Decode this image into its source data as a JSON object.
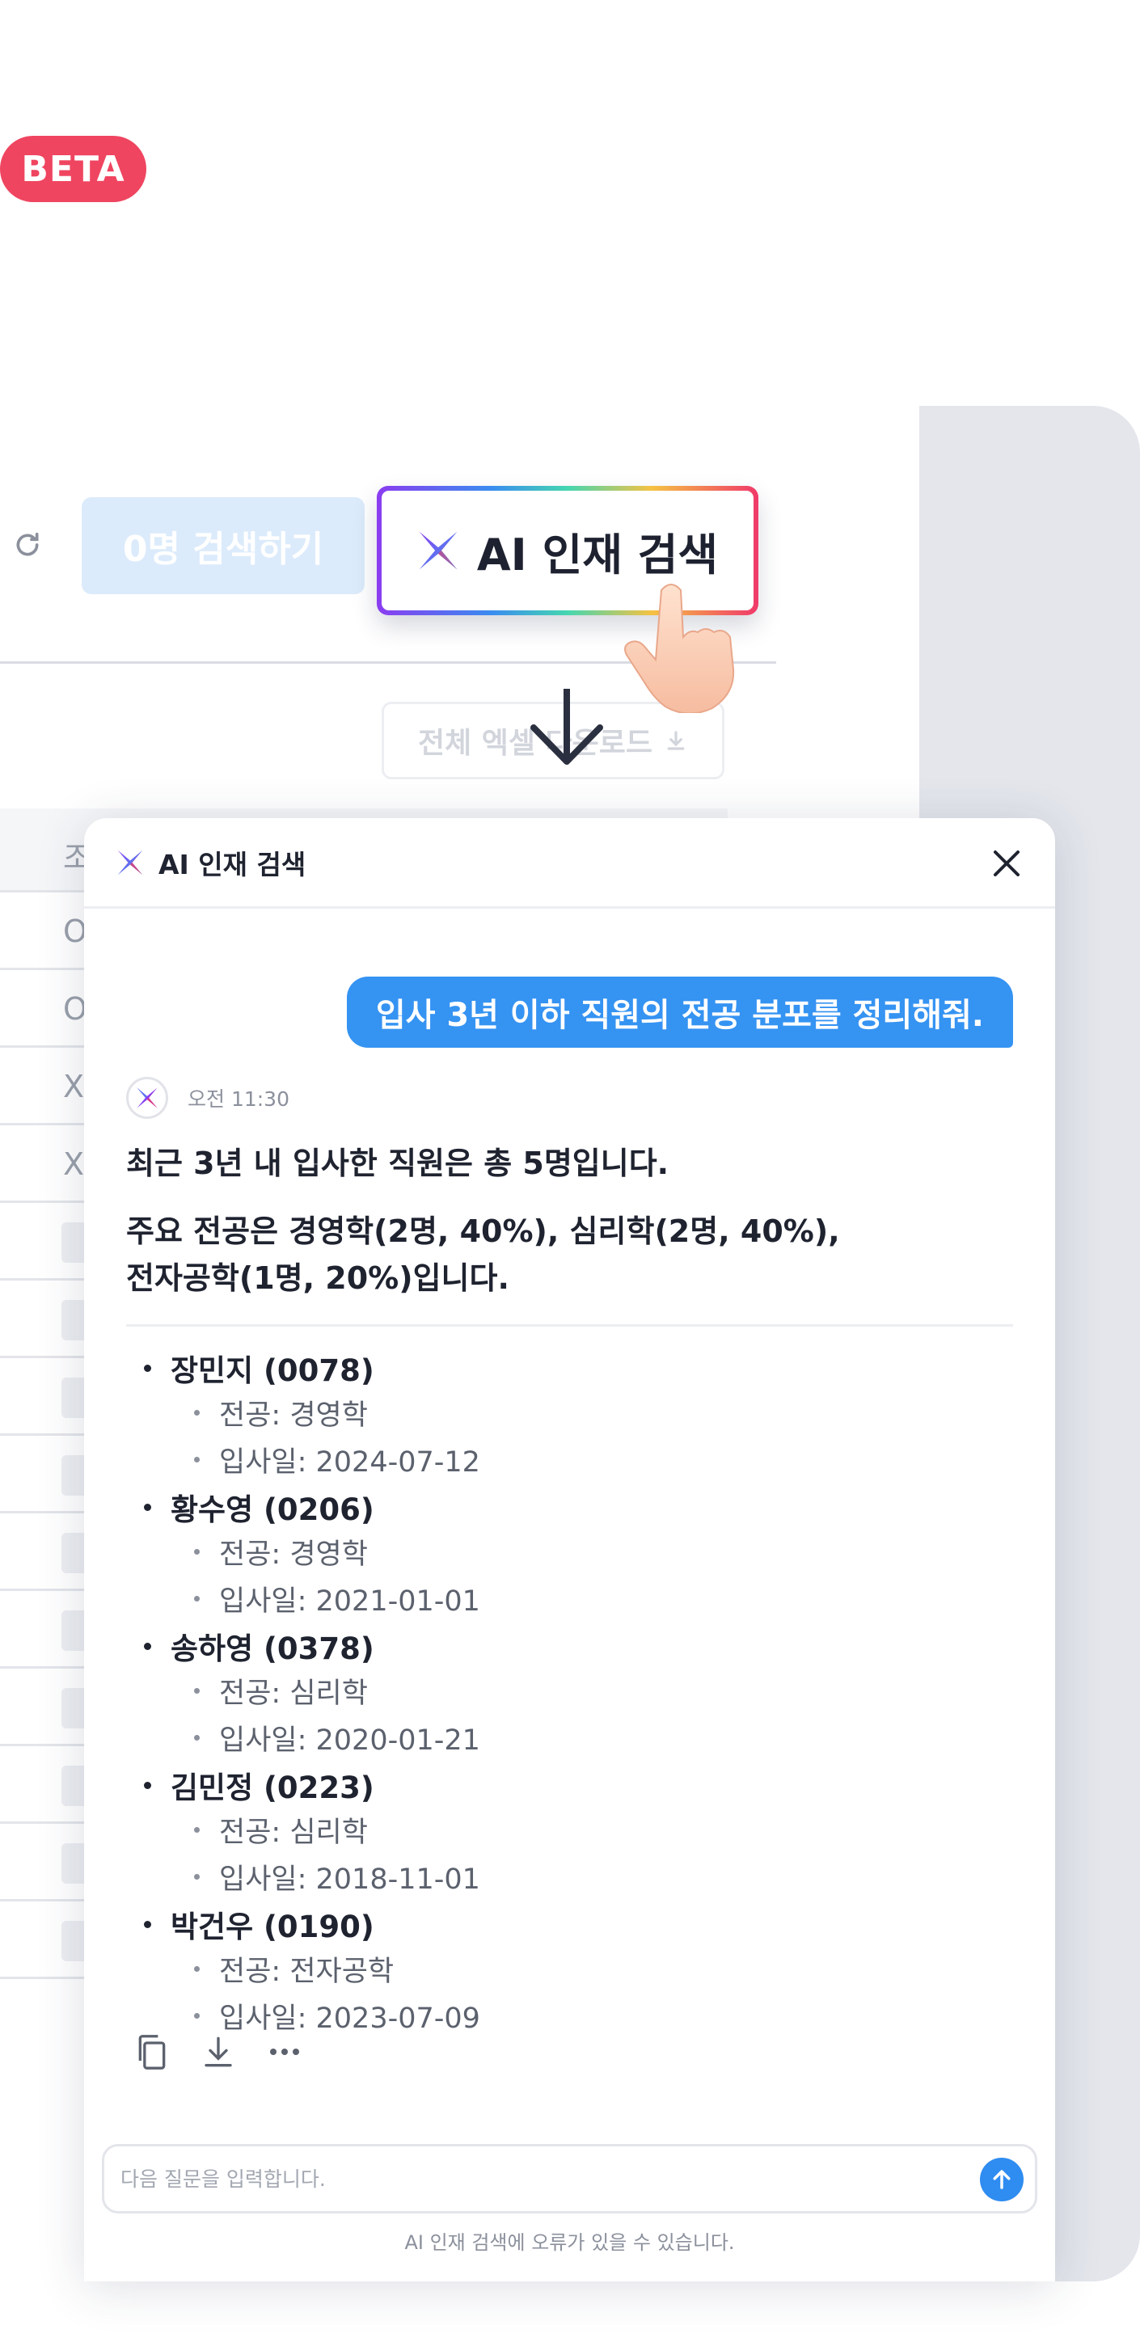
{
  "badge": {
    "label": "BETA",
    "color": "#ef4560"
  },
  "toolbar": {
    "refresh_icon": "refresh-icon",
    "search_count_button": "0명 검색하기",
    "ai_search_button": "AI 인재 검색",
    "excel_download_button": "전체 엑셀 다운로드"
  },
  "table": {
    "header_cell": "조",
    "rows": [
      "O",
      "O",
      "X",
      "X",
      "",
      "",
      "",
      "",
      "",
      "",
      "",
      "",
      "",
      ""
    ]
  },
  "chat": {
    "title": "AI 인재 검색",
    "user_message": "입사 3년 이하 직원의 전공 분포를 정리해줘.",
    "bot_time": "오전 11:30",
    "answer_summary": "최근 3년 내 입사한 직원은 총 5명입니다.",
    "answer_detail_line1": "주요 전공은 경영학(2명, 40%), 심리학(2명, 40%),",
    "answer_detail_line2": "전자공학(1명, 20%)입니다.",
    "employees": [
      {
        "name": "장민지 (0078)",
        "major": "전공: 경영학",
        "hire_date": "입사일: 2024-07-12"
      },
      {
        "name": "황수영 (0206)",
        "major": "전공: 경영학",
        "hire_date": "입사일: 2021-01-01"
      },
      {
        "name": "송하영 (0378)",
        "major": "전공: 심리학",
        "hire_date": "입사일: 2020-01-21"
      },
      {
        "name": "김민정 (0223)",
        "major": "전공: 심리학",
        "hire_date": "입사일: 2018-11-01"
      },
      {
        "name": "박건우 (0190)",
        "major": "전공: 전자공학",
        "hire_date": "입사일: 2023-07-09"
      }
    ],
    "actions": [
      "copy-icon",
      "download-icon",
      "more-icon"
    ],
    "input_placeholder": "다음 질문을 입력합니다.",
    "disclaimer": "AI 인재 검색에 오류가 있을 수 있습니다."
  },
  "colors": {
    "accent_blue": "#3593f2",
    "send_button": "#2f8cf0",
    "count_button_bg": "#dcebfb",
    "side_panel": "#e4e6ec"
  }
}
